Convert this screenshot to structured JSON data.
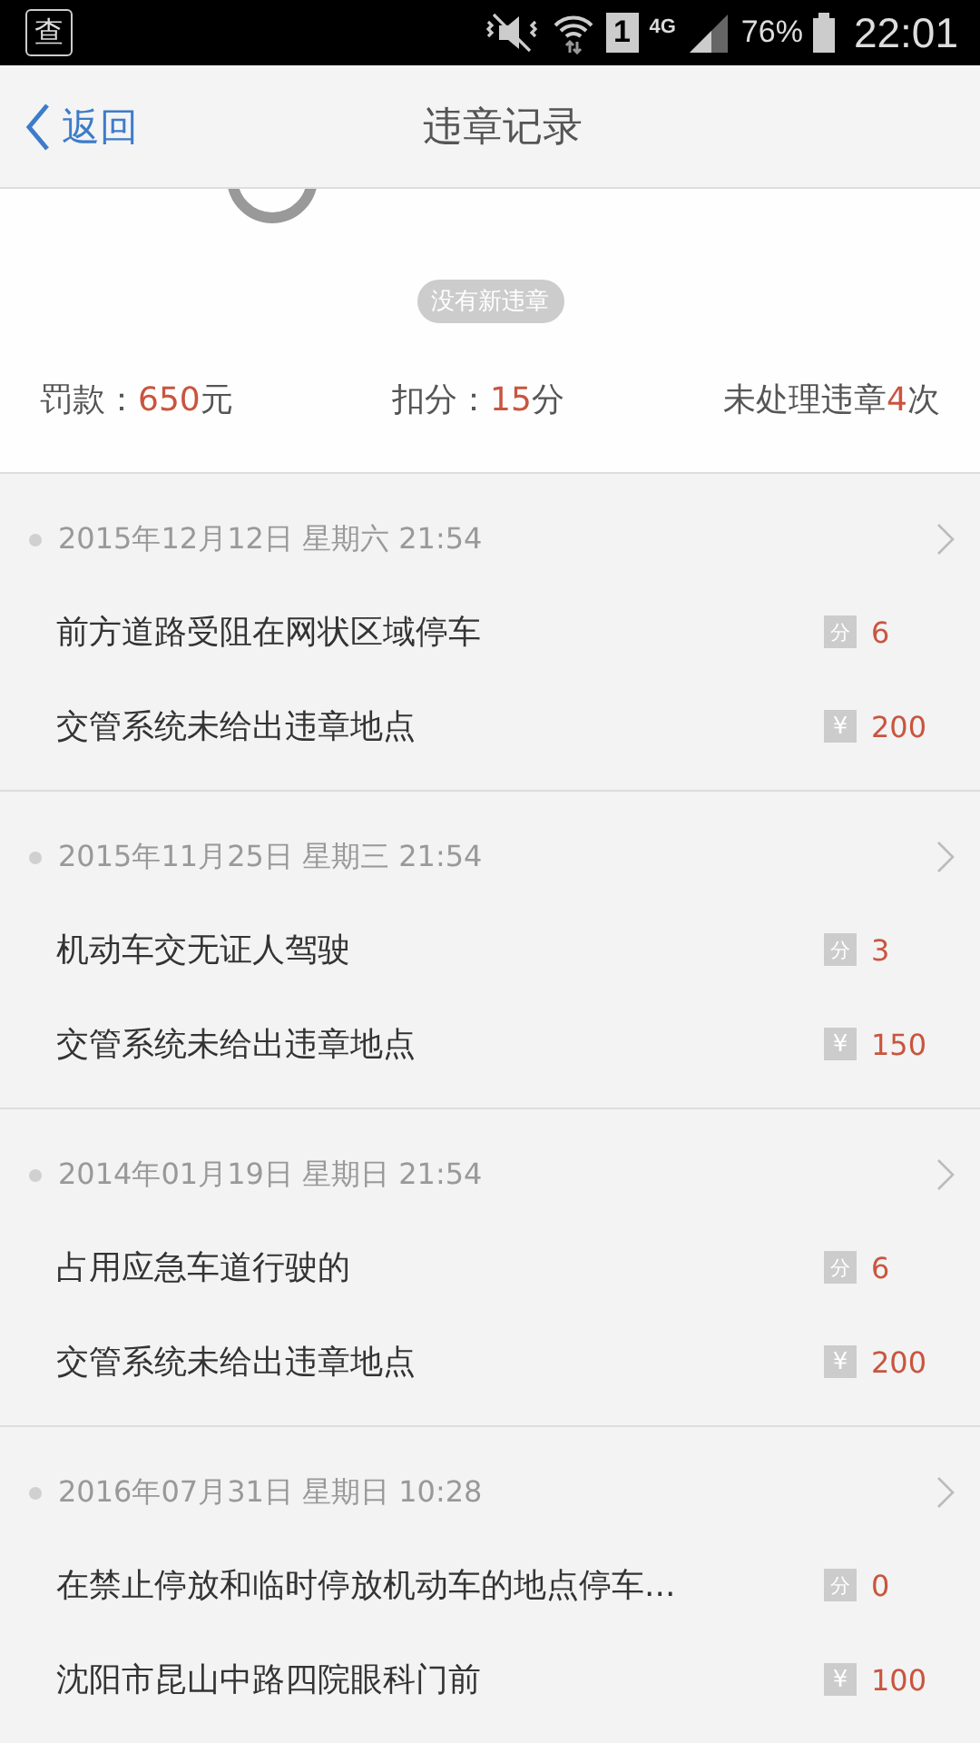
{
  "status_bar": {
    "app_icon": "查",
    "sim": "1",
    "network": "4G",
    "battery": "76%",
    "time": "22:01"
  },
  "header": {
    "back": "返回",
    "title": "违章记录"
  },
  "summary": {
    "badge": "没有新违章",
    "stats": [
      {
        "label": "罚款：",
        "value": "650",
        "unit": "元"
      },
      {
        "label": "扣分：",
        "value": "15",
        "unit": "分"
      },
      {
        "label": "未处理违章",
        "value": "4",
        "unit": "次"
      }
    ]
  },
  "records": [
    {
      "date": "2015年12月12日 星期六 21:54",
      "items": [
        {
          "kind": "points",
          "text": "前方道路受阻在网状区域停车",
          "badge": "分",
          "value": "6"
        },
        {
          "kind": "fine",
          "text": "交管系统未给出违章地点",
          "badge": "¥",
          "value": "200"
        }
      ]
    },
    {
      "date": "2015年11月25日 星期三 21:54",
      "items": [
        {
          "kind": "points",
          "text": "机动车交无证人驾驶",
          "badge": "分",
          "value": "3"
        },
        {
          "kind": "fine",
          "text": "交管系统未给出违章地点",
          "badge": "¥",
          "value": "150"
        }
      ]
    },
    {
      "date": "2014年01月19日 星期日 21:54",
      "items": [
        {
          "kind": "points",
          "text": "占用应急车道行驶的",
          "badge": "分",
          "value": "6"
        },
        {
          "kind": "fine",
          "text": "交管系统未给出违章地点",
          "badge": "¥",
          "value": "200"
        }
      ]
    },
    {
      "date": "2016年07月31日 星期日 10:28",
      "items": [
        {
          "kind": "points",
          "text": "在禁止停放和临时停放机动车的地点停车...",
          "badge": "分",
          "value": "0"
        },
        {
          "kind": "fine",
          "text": "沈阳市昆山中路四院眼科门前",
          "badge": "¥",
          "value": "100"
        }
      ]
    }
  ]
}
